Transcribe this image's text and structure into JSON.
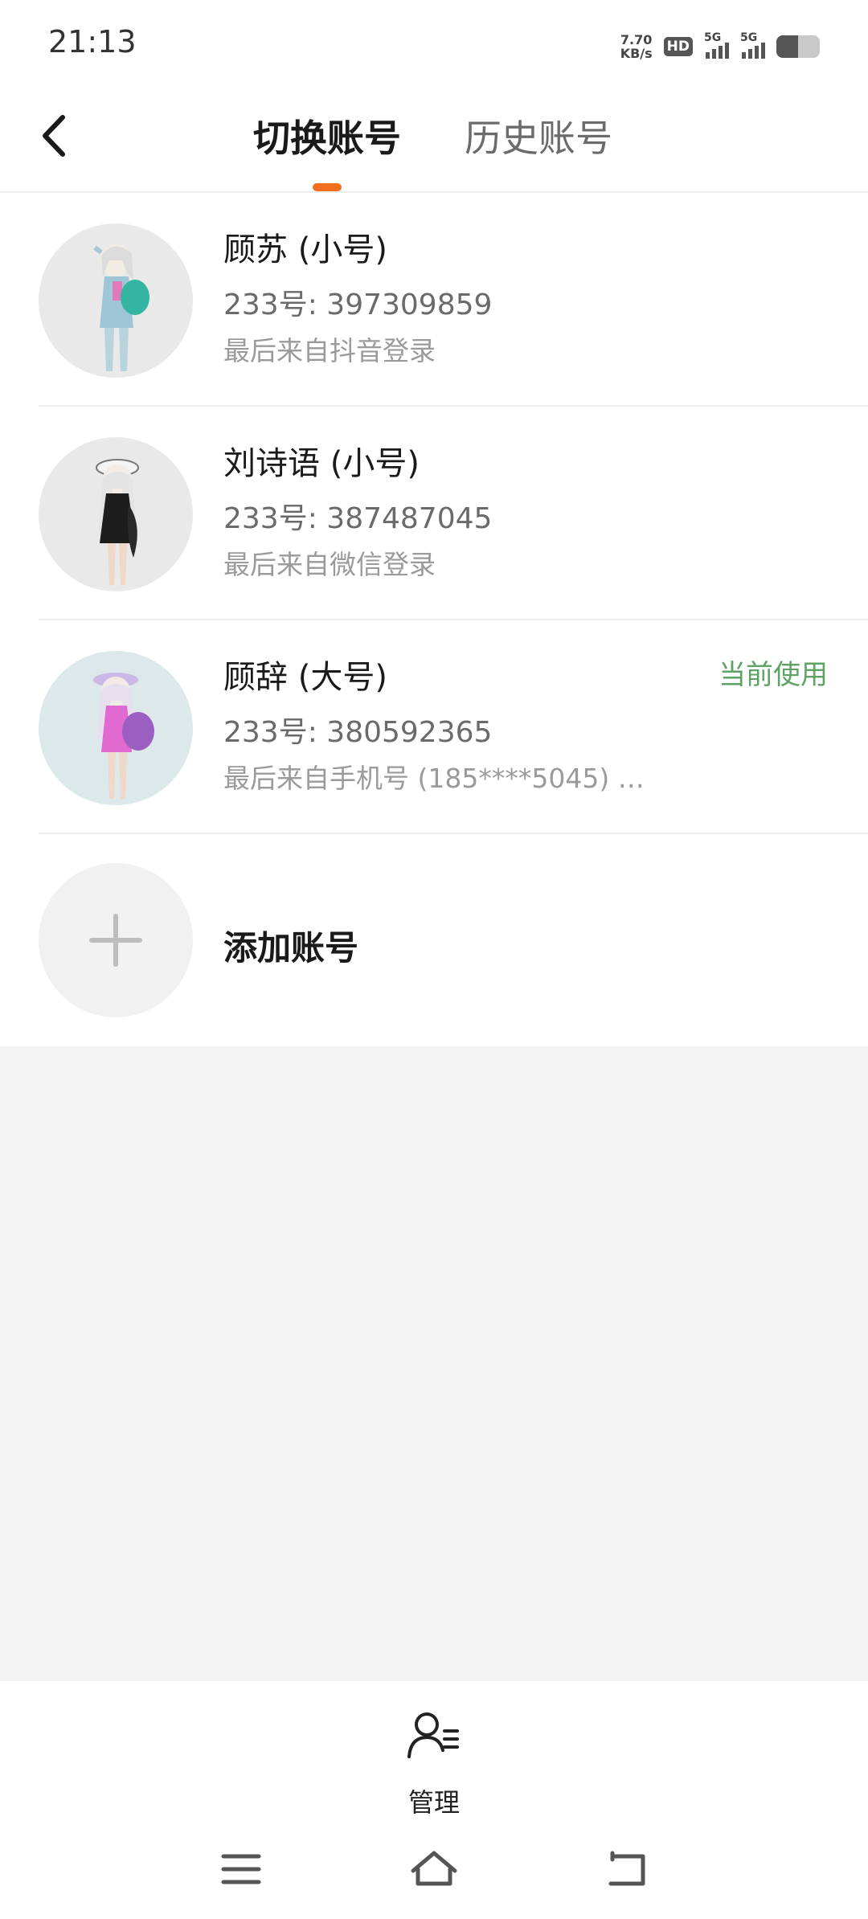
{
  "status_bar": {
    "time": "21:13",
    "net_speed_value": "7.70",
    "net_speed_unit": "KB/s",
    "hd_label": "HD",
    "sim1_label": "5G",
    "sim2_label": "5G",
    "battery_level": 0.5
  },
  "header": {
    "back_icon": "chevron-left-icon",
    "tabs": [
      {
        "label": "切换账号",
        "active": true
      },
      {
        "label": "历史账号",
        "active": false
      }
    ],
    "indicator_color": "#f07020"
  },
  "accounts": [
    {
      "name": "顾苏 (小号)",
      "id_text": "233号: 397309859",
      "source": "最后来自抖音登录",
      "current": ""
    },
    {
      "name": "刘诗语 (小号)",
      "id_text": "233号: 387487045",
      "source": "最后来自微信登录",
      "current": ""
    },
    {
      "name": "顾辞 (大号)",
      "id_text": "233号: 380592365",
      "source": "最后来自手机号 (185****5045) …",
      "current": "当前使用"
    }
  ],
  "add_account": {
    "label": "添加账号",
    "icon": "plus-icon"
  },
  "bottom": {
    "manage_label": "管理",
    "manage_icon": "user-list-icon"
  },
  "nav": {
    "menu_icon": "menu-icon",
    "home_icon": "home-icon",
    "back_icon": "back-icon"
  },
  "colors": {
    "accent": "#f07020",
    "current_green": "#5fa364",
    "background": "#f4f4f4"
  }
}
